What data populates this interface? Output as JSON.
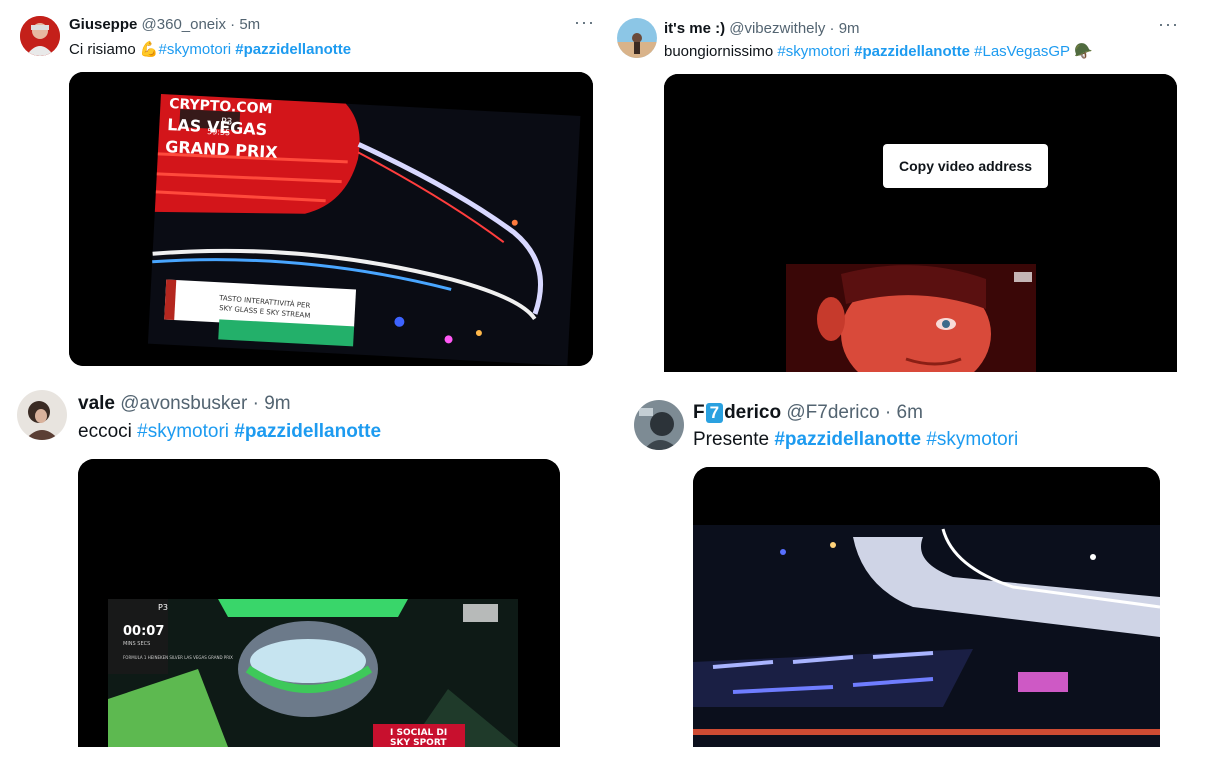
{
  "tweets": [
    {
      "name": "Giuseppe",
      "handle": "@360_oneix",
      "sep": "·",
      "time": "5m",
      "text_plain": "Ci risiamo",
      "emoji": "💪",
      "tags": [
        "#skymotori",
        "#pazzidellanotte"
      ],
      "overlay_text": {
        "brand_line1": "CRYPTO.COM",
        "brand_line2": "LAS VEGAS",
        "brand_line3": "GRAND PRIX",
        "session": "P3",
        "time": "59:55",
        "banner_line1": "TASTO INTERATTIVITÀ PER",
        "banner_line2": "SKY GLASS E SKY STREAM"
      }
    },
    {
      "name": "it's me :)",
      "handle": "@vibezwithely",
      "sep": "·",
      "time": "9m",
      "text_plain": "buongiornissimo",
      "tags": [
        "#skymotori",
        "#pazzidellanotte",
        "#LasVegasGP"
      ],
      "emoji": "🪖",
      "tooltip": "Copy video address"
    },
    {
      "name": "vale",
      "handle": "@avonsbusker",
      "sep": "·",
      "time": "9m",
      "text_plain": "eccoci",
      "tags": [
        "#skymotori",
        "#pazzidellanotte"
      ],
      "overlay_text": {
        "session": "P3",
        "clock": "00:07",
        "units": "MINS  SECS",
        "info": "FORMULA 1 HEINEKEN SILVER LAS VEGAS GRAND PRIX",
        "sky_line1": "I SOCIAL DI",
        "sky_line2": "SKY SPORT"
      }
    },
    {
      "name_pre": "F",
      "name_badge": "7",
      "name_post": "derico",
      "handle": "@F7derico",
      "sep": "·",
      "time": "6m",
      "text_plain": "Presente",
      "tags": [
        "#pazzidellanotte",
        "#skymotori"
      ]
    }
  ],
  "colors": {
    "link": "#1d9bf0",
    "meta": "#536471",
    "text": "#0f1419"
  },
  "icons": {
    "more": "more-horizontal-icon"
  }
}
